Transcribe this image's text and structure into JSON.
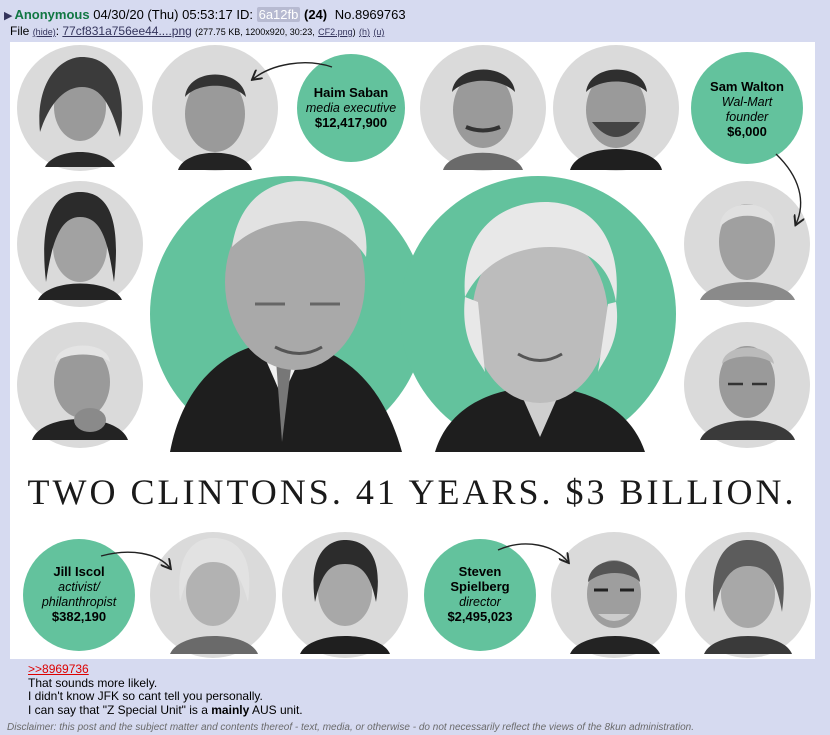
{
  "post": {
    "name": "Anonymous",
    "datetime": "04/30/20 (Thu) 05:53:17",
    "id_label": "ID:",
    "id_value": "6a12fb",
    "post_count": "(24)",
    "post_no": "No.8969763"
  },
  "file": {
    "label": "File",
    "hide": "(hide)",
    "filename": "77cf831a756ee44....png",
    "meta": "(277.75 KB, 1200x920, 30:23,",
    "original_name": "CF2.png",
    "h_link": "(h)",
    "u_link": "(u)"
  },
  "infographic": {
    "headline": "TWO CLINTONS. 41 YEARS. $3 BILLION.",
    "accent_color": "#63c29d",
    "donors": [
      {
        "name": "Haim Saban",
        "role": "media executive",
        "amount": "$12,417,900"
      },
      {
        "name": "Sam Walton",
        "role": "Wal-Mart founder",
        "role_lines": [
          "Wal-Mart",
          "founder"
        ],
        "amount": "$6,000"
      },
      {
        "name": "Jill Iscol",
        "role": "activist/ philanthropist",
        "role_lines": [
          "activist/",
          "philanthropist"
        ],
        "amount": "$382,190"
      },
      {
        "name": "Steven Spielberg",
        "name_lines": [
          "Steven",
          "Spielberg"
        ],
        "role": "director",
        "amount": "$2,495,023"
      }
    ]
  },
  "message": {
    "quote_link": ">>8969736",
    "lines": [
      "That sounds more likely.",
      "I didn't know JFK so cant tell you personally."
    ],
    "last_line_pre": "I can say that \"Z Special Unit\" is a ",
    "last_line_bold": "mainly",
    "last_line_post": " AUS unit."
  },
  "disclaimer": "Disclaimer: this post and the subject matter and contents thereof - text, media, or otherwise - do not necessarily reflect the views of the 8kun administration."
}
